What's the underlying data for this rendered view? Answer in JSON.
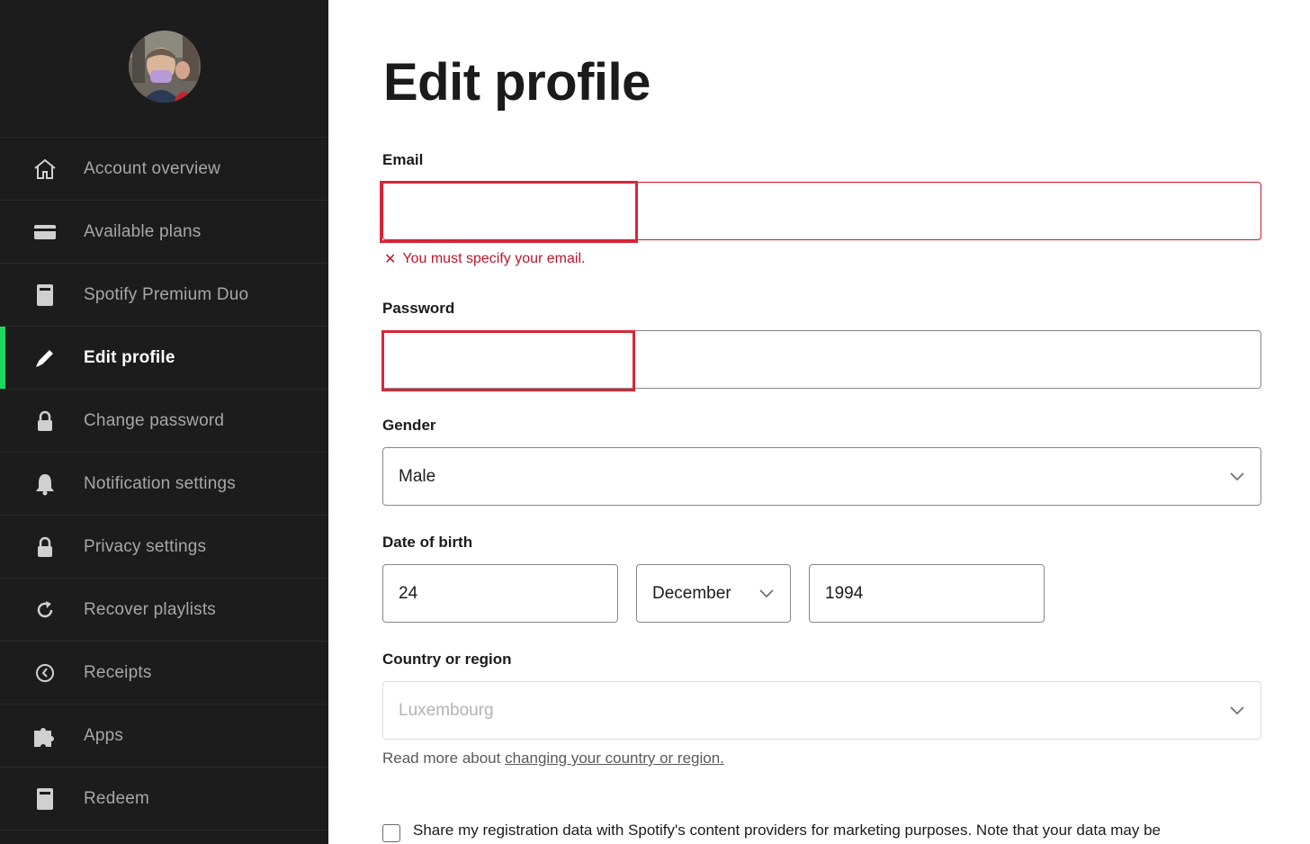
{
  "sidebar": {
    "items": [
      {
        "label": "Account overview",
        "icon": "home-icon",
        "active": false
      },
      {
        "label": "Available plans",
        "icon": "card-icon",
        "active": false
      },
      {
        "label": "Spotify Premium Duo",
        "icon": "receipt-icon",
        "active": false
      },
      {
        "label": "Edit profile",
        "icon": "pencil-icon",
        "active": true
      },
      {
        "label": "Change password",
        "icon": "lock-icon",
        "active": false
      },
      {
        "label": "Notification settings",
        "icon": "bell-icon",
        "active": false
      },
      {
        "label": "Privacy settings",
        "icon": "lock-icon",
        "active": false
      },
      {
        "label": "Recover playlists",
        "icon": "refresh-icon",
        "active": false
      },
      {
        "label": "Receipts",
        "icon": "clock-icon",
        "active": false
      },
      {
        "label": "Apps",
        "icon": "puzzle-icon",
        "active": false
      },
      {
        "label": "Redeem",
        "icon": "receipt-icon",
        "active": false
      }
    ]
  },
  "main": {
    "title": "Edit profile",
    "email": {
      "label": "Email",
      "value": "",
      "error": "You must specify your email."
    },
    "password": {
      "label": "Password",
      "value": ""
    },
    "gender": {
      "label": "Gender",
      "value": "Male"
    },
    "dob": {
      "label": "Date of birth",
      "day": "24",
      "month": "December",
      "year": "1994"
    },
    "country": {
      "label": "Country or region",
      "value": "Luxembourg"
    },
    "help": {
      "prefix": "Read more about ",
      "link": "changing your country or region."
    },
    "marketing": {
      "label": "Share my registration data with Spotify's content providers for marketing purposes. Note that your data may be"
    }
  },
  "colors": {
    "accent": "#1ed760",
    "error": "#d31225",
    "sidebar_bg": "#1c1c1c"
  }
}
